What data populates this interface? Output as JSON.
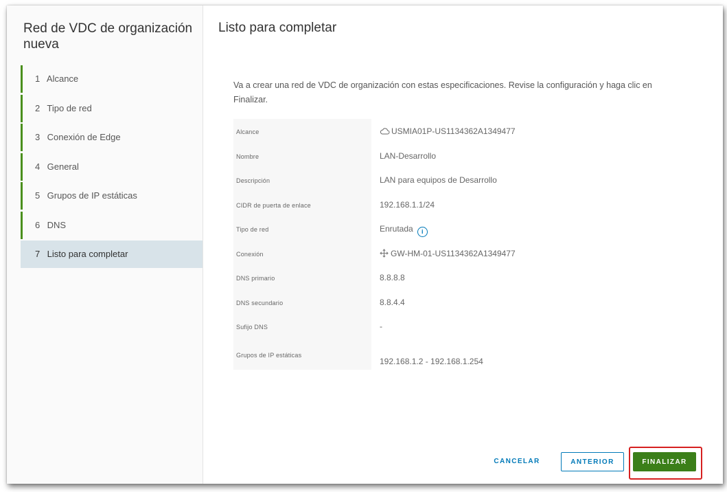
{
  "wizard": {
    "title": "Red de VDC de organización nueva",
    "steps": [
      {
        "num": "1",
        "label": "Alcance"
      },
      {
        "num": "2",
        "label": "Tipo de red"
      },
      {
        "num": "3",
        "label": "Conexión de Edge"
      },
      {
        "num": "4",
        "label": "General"
      },
      {
        "num": "5",
        "label": "Grupos de IP estáticas"
      },
      {
        "num": "6",
        "label": "DNS"
      },
      {
        "num": "7",
        "label": "Listo para completar"
      }
    ],
    "active_step": 7
  },
  "content": {
    "title": "Listo para completar",
    "intro": "Va a crear una red de VDC de organización con estas especificaciones. Revise la configuración y haga clic en Finalizar.",
    "review": [
      {
        "label": "Alcance",
        "value": "USMIA01P-US1134362A1349477",
        "icon": "cloud-icon"
      },
      {
        "label": "Nombre",
        "value": "LAN-Desarrollo"
      },
      {
        "label": "Descripción",
        "value": "LAN para equipos de Desarrollo"
      },
      {
        "label": "CIDR de puerta de enlace",
        "value": "192.168.1.1/24"
      },
      {
        "label": "Tipo de red",
        "value": "Enrutada",
        "icon": "info-icon"
      },
      {
        "label": "Conexión",
        "value": "GW-HM-01-US1134362A1349477",
        "icon": "edge-gateway-icon"
      },
      {
        "label": "DNS primario",
        "value": "8.8.8.8"
      },
      {
        "label": "DNS secundario",
        "value": "8.8.4.4"
      },
      {
        "label": "Sufijo DNS",
        "value": "-"
      },
      {
        "label": "Grupos de IP estáticas",
        "value": "192.168.1.2 - 192.168.1.254"
      }
    ]
  },
  "footer": {
    "cancel_label": "CANCELAR",
    "back_label": "ANTERIOR",
    "finish_label": "FINALIZAR"
  },
  "colors": {
    "primary_blue": "#0079b8",
    "success_green": "#3b7f19",
    "step_bar_green": "#4a8f1c",
    "active_step_bg": "#d8e3e9",
    "highlight_red": "#d62020"
  }
}
